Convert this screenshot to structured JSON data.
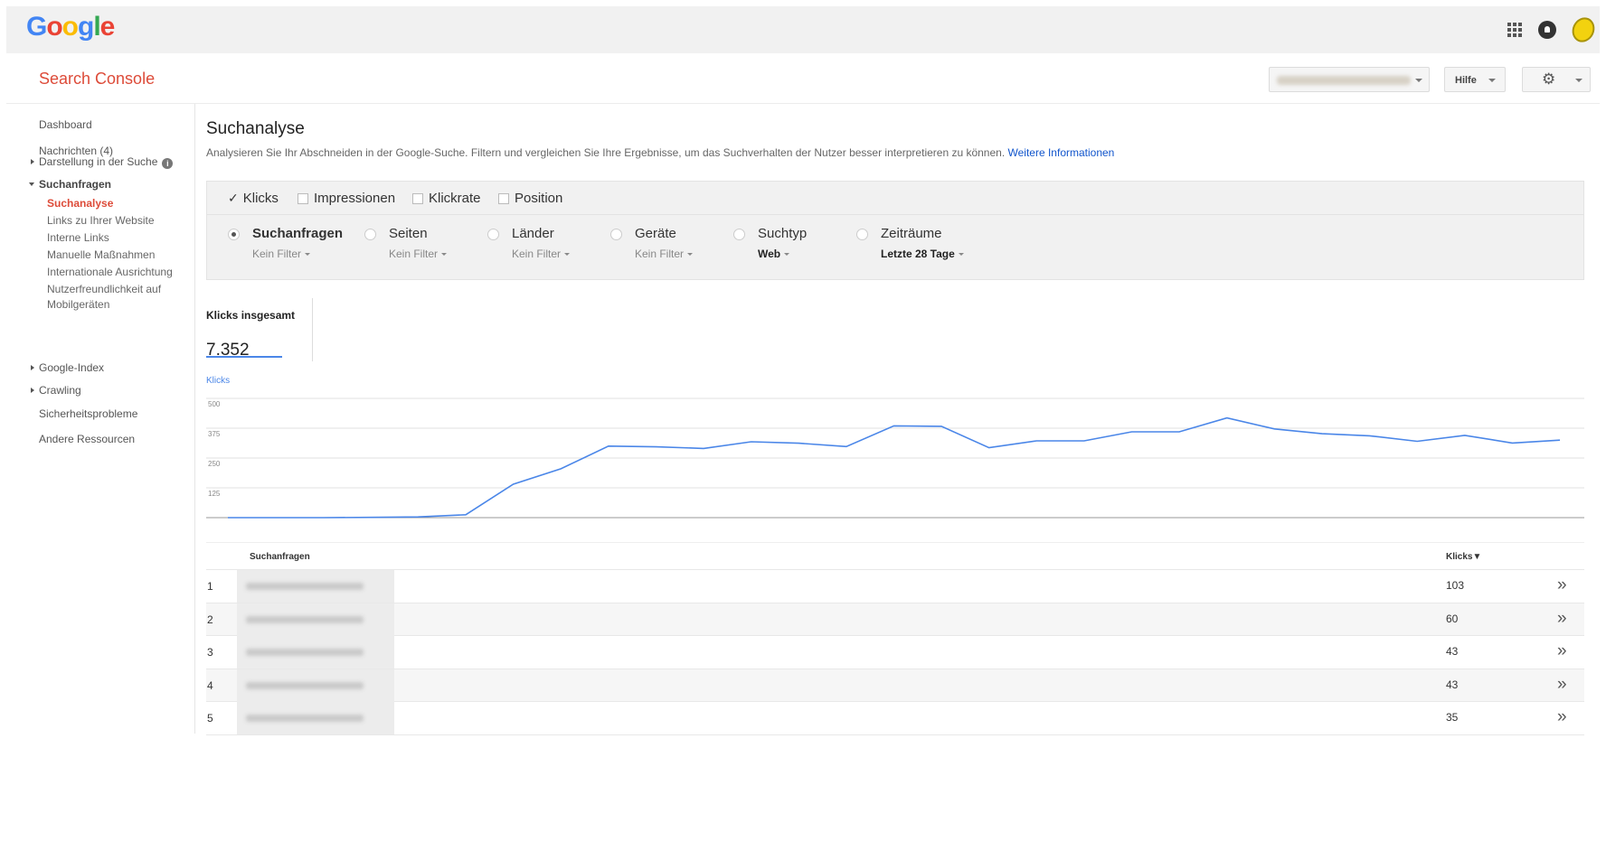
{
  "header": {
    "logo_letters": [
      {
        "char": "G",
        "color": "#4285f4"
      },
      {
        "char": "o",
        "color": "#ea4335"
      },
      {
        "char": "o",
        "color": "#fbbc05"
      },
      {
        "char": "g",
        "color": "#4285f4"
      },
      {
        "char": "l",
        "color": "#34a853"
      },
      {
        "char": "e",
        "color": "#ea4335"
      }
    ],
    "icons": [
      "apps-grid-icon",
      "notifications-icon",
      "avatar"
    ]
  },
  "console": {
    "title": "Search Console",
    "help_label": "Hilfe",
    "settings_icon": "⚙"
  },
  "sidebar": {
    "dashboard": "Dashboard",
    "messages": "Nachrichten (4)",
    "search_appearance": "Darstellung in der Suche",
    "search_traffic": "Suchanfragen",
    "sub_items": [
      "Suchanalyse",
      "Links zu Ihrer Website",
      "Interne Links",
      "Manuelle Maßnahmen",
      "Internationale Ausrichtung",
      "Nutzerfreundlichkeit auf",
      "Mobilgeräten"
    ],
    "google_index": "Google-Index",
    "crawling": "Crawling",
    "security": "Sicherheitsprobleme",
    "other": "Andere Ressourcen"
  },
  "page": {
    "title": "Suchanalyse",
    "description": "Analysieren Sie Ihr Abschneiden in der Google-Suche. Filtern und vergleichen Sie Ihre Ergebnisse, um das Suchverhalten der Nutzer besser interpretieren zu können.",
    "more_info": "Weitere Informationen"
  },
  "metrics": {
    "clicks": "Klicks",
    "impressions": "Impressionen",
    "ctr": "Klickrate",
    "position": "Position"
  },
  "groups": [
    {
      "label": "Suchanfragen",
      "filter": "Kein Filter",
      "selected": true
    },
    {
      "label": "Seiten",
      "filter": "Kein Filter",
      "selected": false
    },
    {
      "label": "Länder",
      "filter": "Kein Filter",
      "selected": false
    },
    {
      "label": "Geräte",
      "filter": "Kein Filter",
      "selected": false
    },
    {
      "label": "Suchtyp",
      "filter": "Web",
      "selected": false
    },
    {
      "label": "Zeiträume",
      "filter": "Letzte 28 Tage",
      "selected": false
    }
  ],
  "totals": {
    "label": "Klicks insgesamt",
    "value": "7.352"
  },
  "chart_data": {
    "type": "line",
    "ylabel": "Klicks",
    "ylim": [
      0,
      500
    ],
    "yticks": [
      "500",
      "375",
      "250",
      "125"
    ],
    "series": [
      {
        "name": "Klicks",
        "color": "#4a86e8",
        "values": [
          0,
          0,
          0,
          1,
          3,
          12,
          140,
          205,
          300,
          297,
          290,
          318,
          312,
          298,
          385,
          383,
          293,
          322,
          322,
          360,
          360,
          418,
          372,
          352,
          343,
          320,
          345,
          313,
          325
        ]
      }
    ]
  },
  "table": {
    "col_query": "Suchanfragen",
    "col_clicks": "Klicks▼",
    "rows": [
      {
        "num": "1",
        "clicks": "103"
      },
      {
        "num": "2",
        "clicks": "60"
      },
      {
        "num": "3",
        "clicks": "43"
      },
      {
        "num": "4",
        "clicks": "43"
      },
      {
        "num": "5",
        "clicks": "35"
      }
    ],
    "arrow": "»"
  }
}
